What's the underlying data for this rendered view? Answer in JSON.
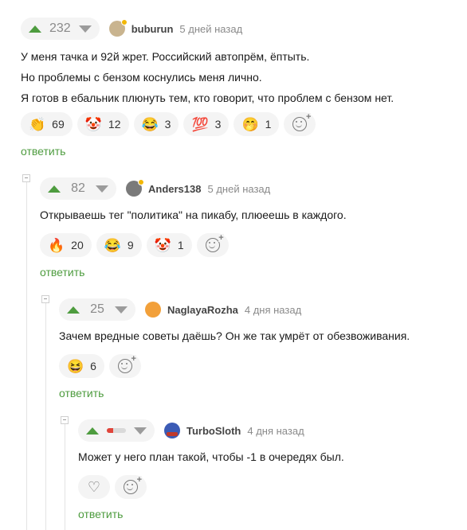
{
  "ui": {
    "reply_label": "ответить"
  },
  "comments": [
    {
      "score": "232",
      "username": "buburun",
      "time": "5 дней назад",
      "lines": [
        "У меня тачка и 92й жрет. Российский автопрём, ёптыть.",
        "Но проблемы с бензом коснулись меня лично.",
        "Я готов в ебальник плюнуть тем, кто говорит, что проблем с бензом нет."
      ],
      "reactions": [
        {
          "emoji": "👏",
          "icon": "clap-icon",
          "count": "69"
        },
        {
          "emoji": "🤡",
          "icon": "clown-icon",
          "count": "12"
        },
        {
          "emoji": "😂",
          "icon": "laugh-icon",
          "count": "3"
        },
        {
          "emoji": "💯",
          "icon": "hundred-icon",
          "count": "3"
        },
        {
          "emoji": "🤭",
          "icon": "oops-icon",
          "count": "1"
        }
      ]
    },
    {
      "score": "82",
      "username": "Anders138",
      "time": "5 дней назад",
      "lines": [
        "Открываешь тег \"политика\" на пикабу, плюеешь в каждого."
      ],
      "reactions": [
        {
          "emoji": "🔥",
          "icon": "fire-icon",
          "count": "20"
        },
        {
          "emoji": "😂",
          "icon": "laugh-icon",
          "count": "9"
        },
        {
          "emoji": "🤡",
          "icon": "clown-icon",
          "count": "1"
        }
      ]
    },
    {
      "score": "25",
      "username": "NaglayaRozha",
      "time": "4 дня назад",
      "lines": [
        "Зачем вредные советы даёшь? Он же так умрёт от обезвоживания."
      ],
      "reactions": [
        {
          "emoji": "😆",
          "icon": "grin-icon",
          "count": "6"
        }
      ]
    },
    {
      "score_bar_fraction": 0.35,
      "username": "TurboSloth",
      "time": "4 дня назад",
      "lines": [
        "Может у него план такой, чтобы -1 в очередях был."
      ],
      "reactions": []
    }
  ],
  "colors": {
    "accent": "#4e9c3f",
    "negative": "#e0443a",
    "online": "#f2b705"
  }
}
